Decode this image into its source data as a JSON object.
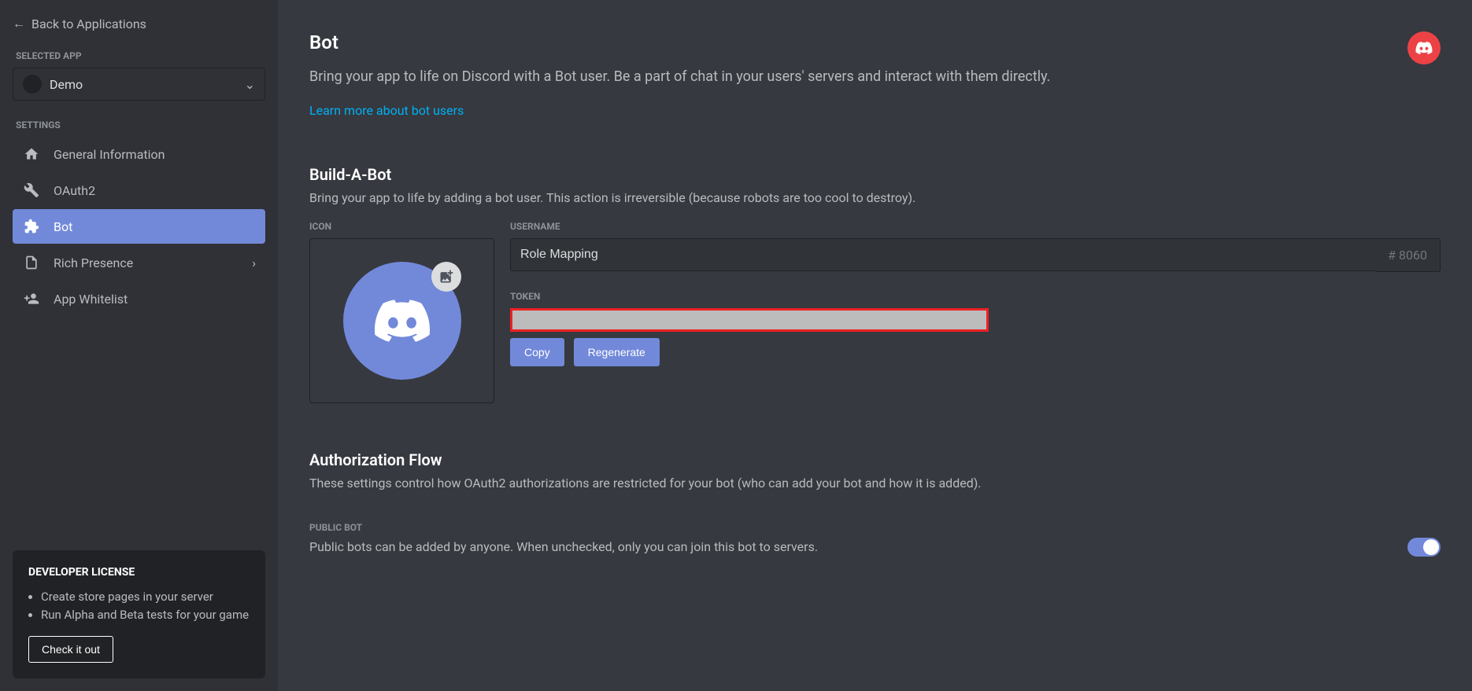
{
  "back_link": "Back to Applications",
  "sidebar": {
    "selected_label": "SELECTED APP",
    "app_name": "Demo",
    "settings_label": "SETTINGS",
    "items": [
      {
        "label": "General Information"
      },
      {
        "label": "OAuth2"
      },
      {
        "label": "Bot"
      },
      {
        "label": "Rich Presence"
      },
      {
        "label": "App Whitelist"
      }
    ]
  },
  "dev_license": {
    "title": "DEVELOPER LICENSE",
    "bullets": [
      "Create store pages in your server",
      "Run Alpha and Beta tests for your game"
    ],
    "button": "Check it out"
  },
  "page": {
    "title": "Bot",
    "description": "Bring your app to life on Discord with a Bot user. Be a part of chat in your users' servers and interact with them directly.",
    "learn_more": "Learn more about bot users"
  },
  "build": {
    "title": "Build-A-Bot",
    "desc": "Bring your app to life by adding a bot user. This action is irreversible (because robots are too cool to destroy).",
    "icon_label": "ICON",
    "username_label": "USERNAME",
    "username_value": "Role Mapping",
    "discriminator": "8060",
    "token_label": "TOKEN",
    "copy": "Copy",
    "regenerate": "Regenerate"
  },
  "auth_flow": {
    "title": "Authorization Flow",
    "desc": "These settings control how OAuth2 authorizations are restricted for your bot (who can add your bot and how it is added)."
  },
  "public_bot": {
    "label": "PUBLIC BOT",
    "desc": "Public bots can be added by anyone. When unchecked, only you can join this bot to servers."
  }
}
